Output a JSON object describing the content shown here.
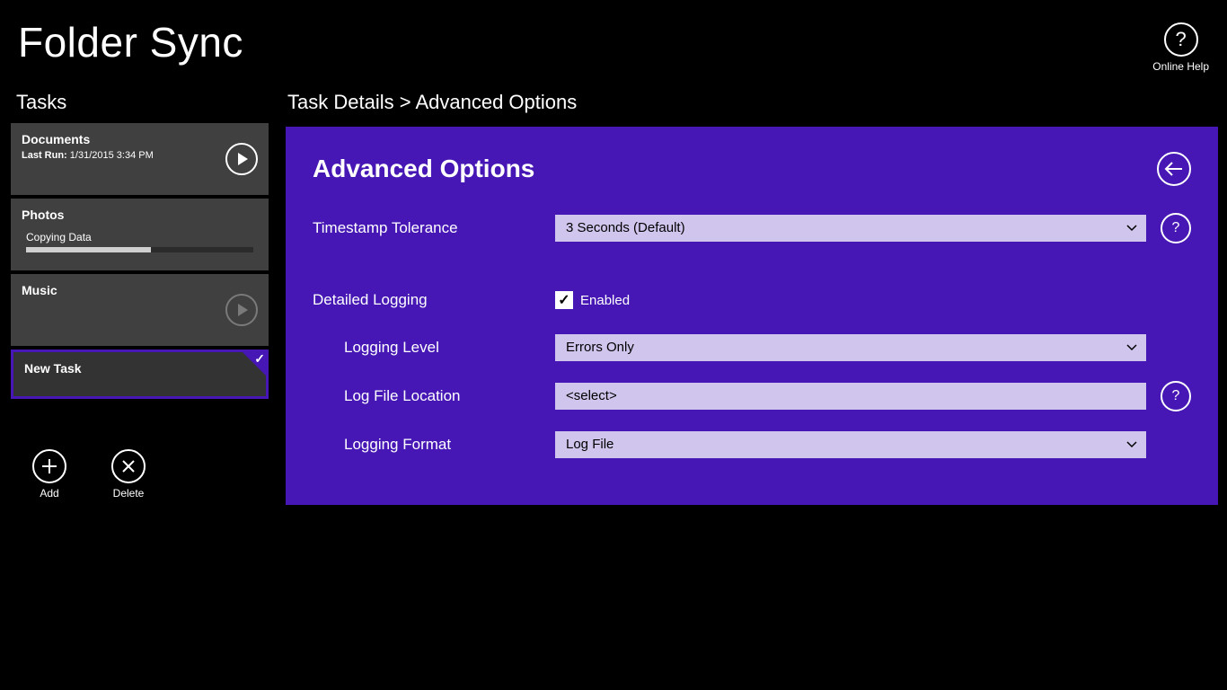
{
  "app": {
    "title": "Folder Sync",
    "onlineHelpLabel": "Online Help"
  },
  "sidebar": {
    "heading": "Tasks",
    "tasks": [
      {
        "name": "Documents",
        "lastRunLabel": "Last Run:",
        "lastRun": "1/31/2015 3:34 PM"
      },
      {
        "name": "Photos",
        "status": "Copying Data",
        "progressPercent": 55
      },
      {
        "name": "Music"
      },
      {
        "name": "New Task",
        "selected": true
      }
    ],
    "addLabel": "Add",
    "deleteLabel": "Delete"
  },
  "main": {
    "breadcrumb": "Task Details  >  Advanced Options",
    "panelTitle": "Advanced Options",
    "fields": {
      "timestampLabel": "Timestamp Tolerance",
      "timestampValue": "3 Seconds (Default)",
      "detailedLoggingLabel": "Detailed Logging",
      "enabledLabel": "Enabled",
      "enabledChecked": true,
      "loggingLevelLabel": "Logging Level",
      "loggingLevelValue": "Errors Only",
      "logFileLocationLabel": "Log File Location",
      "logFileLocationValue": "<select>",
      "loggingFormatLabel": "Logging Format",
      "loggingFormatValue": "Log File"
    }
  }
}
